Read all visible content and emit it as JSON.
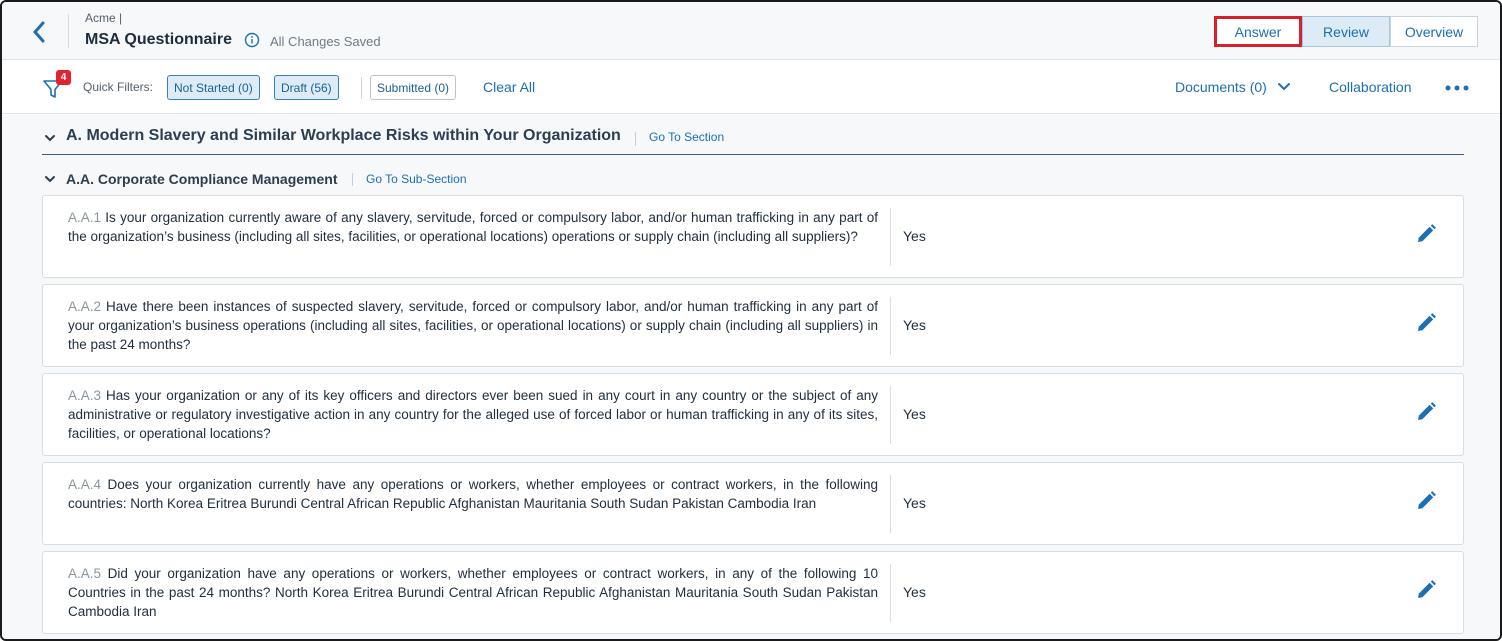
{
  "header": {
    "company": "Acme |",
    "title": "MSA Questionnaire",
    "save_status": "All Changes Saved",
    "view_tabs": [
      {
        "label": "Answer",
        "highlighted": true
      },
      {
        "label": "Review",
        "selected": true
      },
      {
        "label": "Overview"
      }
    ]
  },
  "filterbar": {
    "filter_count": "4",
    "quick_filters_label": "Quick Filters:",
    "chips": [
      {
        "label": "Not Started (0)",
        "active": true
      },
      {
        "label": "Draft (56)",
        "active": true
      },
      {
        "label": "Submitted (0)",
        "active": false
      }
    ],
    "clear_all": "Clear All",
    "documents": "Documents (0)",
    "collaboration": "Collaboration"
  },
  "section": {
    "title": "A. Modern Slavery and Similar Workplace Risks within Your Organization",
    "go_link": "Go To Section"
  },
  "subsection": {
    "title": "A.A. Corporate Compliance Management",
    "go_link": "Go To Sub-Section"
  },
  "questions": [
    {
      "num": "A.A.1",
      "text": " Is your organization currently aware of any slavery, servitude, forced or compulsory labor, and/or human trafficking in any part of the organization’s business (including all sites, facilities, or operational locations) operations or supply chain (including all suppliers)?",
      "answer": "Yes"
    },
    {
      "num": "A.A.2",
      "text": " Have there been instances of suspected slavery, servitude, forced or compulsory labor, and/or human trafficking in any part of your organization’s business operations (including all sites, facilities, or operational locations) or supply chain (including all suppliers) in the past 24 months?",
      "answer": "Yes"
    },
    {
      "num": "A.A.3",
      "text": " Has your organization or any of its key officers and directors ever been sued in any court in any country or the subject of any administrative or regulatory investigative action in any country for the alleged use of forced labor or human trafficking in any of its sites, facilities, or operational locations?",
      "answer": "Yes"
    },
    {
      "num": "A.A.4",
      "text": " Does your organization currently have any operations or workers, whether employees or contract workers, in the following countries: North Korea Eritrea Burundi Central African Republic Afghanistan Mauritania South Sudan Pakistan Cambodia Iran",
      "answer": "Yes"
    },
    {
      "num": "A.A.5",
      "text": " Did your organization have any operations or workers, whether employees or contract workers, in any of the following 10 Countries in the past 24 months? North Korea Eritrea Burundi Central African Republic Afghanistan Mauritania South Sudan Pakistan Cambodia Iran",
      "answer": "Yes"
    }
  ],
  "colors": {
    "accent": "#1d6fb3",
    "highlight_border": "#d4212c",
    "badge": "#e0242f"
  },
  "icons": {
    "back": "chevron-left-icon",
    "info": "info-icon",
    "filter": "filter-icon",
    "documents_toggle": "chevron-down-icon",
    "more": "more-horizontal-icon",
    "edit": "pencil-icon",
    "collapse": "chevron-down-icon"
  }
}
